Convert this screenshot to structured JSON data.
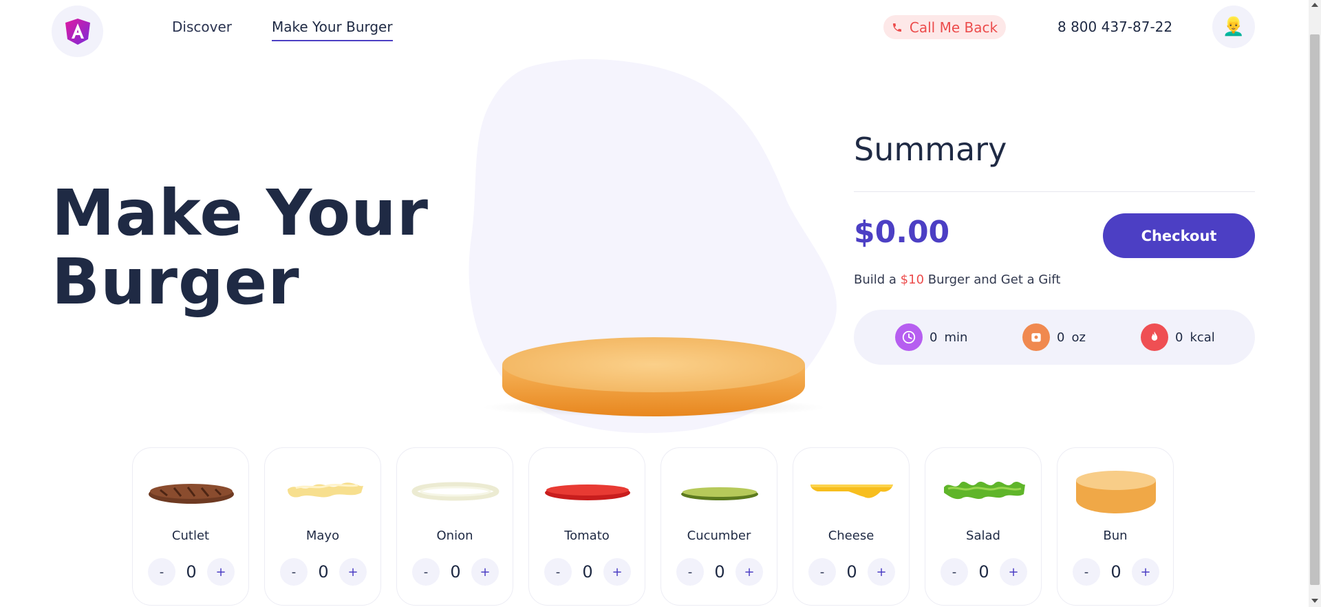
{
  "nav": {
    "links": [
      {
        "label": "Discover"
      },
      {
        "label": "Make Your Burger"
      }
    ]
  },
  "header": {
    "call_label": "Call Me Back",
    "phone": "8 800 437-87-22",
    "avatar_emoji": "👱‍♂️",
    "logo_icon": "angular-logo-icon"
  },
  "hero": {
    "title_line1": "Make Your",
    "title_line2": "Burger"
  },
  "summary": {
    "title": "Summary",
    "price": "$0.00",
    "checkout_label": "Checkout",
    "gift_prefix": "Build a ",
    "gift_amount": "$10",
    "gift_suffix": " Burger and Get a Gift",
    "stats": [
      {
        "value": "0",
        "unit": "min",
        "icon": "clock-icon",
        "color": "#b65ef0"
      },
      {
        "value": "0",
        "unit": "oz",
        "icon": "weight-icon",
        "color": "#f0894f"
      },
      {
        "value": "0",
        "unit": "kcal",
        "icon": "flame-icon",
        "color": "#ef4f53"
      }
    ]
  },
  "ingredients": [
    {
      "name": "Cutlet",
      "count": "0"
    },
    {
      "name": "Mayo",
      "count": "0"
    },
    {
      "name": "Onion",
      "count": "0"
    },
    {
      "name": "Tomato",
      "count": "0"
    },
    {
      "name": "Cucumber",
      "count": "0"
    },
    {
      "name": "Cheese",
      "count": "0"
    },
    {
      "name": "Salad",
      "count": "0"
    },
    {
      "name": "Bun",
      "count": "0"
    }
  ],
  "stepper": {
    "minus": "-",
    "plus": "+"
  },
  "colors": {
    "accent": "#4c3fc4",
    "danger": "#ec4c4c",
    "soft_bg": "#f2f2fb",
    "text": "#1f2a44"
  }
}
